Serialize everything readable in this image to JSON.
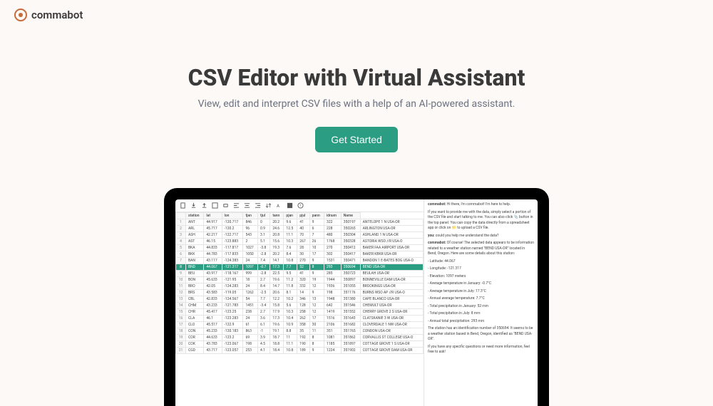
{
  "brand": {
    "name": "commabot"
  },
  "hero": {
    "title": "CSV Editor with Virtual Assistant",
    "subtitle": "View, edit and interpret CSV files with a help of an AI-powered assistant.",
    "cta": "Get Started"
  },
  "sheet": {
    "columns": [
      "station",
      "lat",
      "lon",
      "tjan",
      "tjul",
      "tann",
      "pjan",
      "pjul",
      "pann",
      "idnum",
      "Name"
    ],
    "rows": [
      {
        "n": 1,
        "c": [
          "ANT",
          "44.917",
          "-120.717",
          "846",
          "0",
          "20.2",
          "9.6",
          "41",
          "9",
          "322",
          "350197",
          "ANTELOPE 1 N USA-OR"
        ]
      },
      {
        "n": 2,
        "c": [
          "ARL",
          "45.717",
          "-120.2",
          "96",
          "0.9",
          "24.6",
          "12.5",
          "40",
          "6",
          "228",
          "350265",
          "ARLINGTON USA-OR"
        ]
      },
      {
        "n": 3,
        "c": [
          "ASH",
          "42.217",
          "-122.717",
          "543",
          "3.1",
          "20.8",
          "11.1",
          "70",
          "7",
          "480",
          "350304",
          "ASHLAND 1 N USA-OR"
        ]
      },
      {
        "n": 4,
        "c": [
          "AST",
          "46.15",
          "-123.883",
          "2",
          "5.1",
          "15.6",
          "10.3",
          "267",
          "26",
          "1768",
          "350328",
          "ASTORIA WSO //R USA-O"
        ]
      },
      {
        "n": 5,
        "c": [
          "BKA",
          "44.833",
          "-117.817",
          "1027",
          "-3.8",
          "19.3",
          "7.6",
          "28",
          "10",
          "270",
          "350412",
          "BAKER FAA AIRPORT USA-OR"
        ]
      },
      {
        "n": 6,
        "c": [
          "BKK",
          "44.783",
          "-117.833",
          "1050",
          "-2.8",
          "20.2",
          "8.4",
          "30",
          "17",
          "302",
          "350417",
          "BAKER KBKR USA-OR"
        ]
      },
      {
        "n": 7,
        "c": [
          "BAN",
          "43.117",
          "-124.383",
          "24",
          "7.4",
          "14.1",
          "10.8",
          "270",
          "9",
          "1531",
          "350471",
          "BANDON 1 E-BATES BOG USA-O"
        ]
      },
      {
        "n": 8,
        "sel": true,
        "c": [
          "BND",
          "44.067",
          "-121.317",
          "1097",
          "-0.7",
          "17.3",
          "7.7",
          "52",
          "8",
          "293",
          "350694",
          "BEND USA-OR"
        ]
      },
      {
        "n": 9,
        "c": [
          "BEU",
          "43.917",
          "-118.167",
          "999",
          "-2.8",
          "22.5",
          "9.5",
          "41",
          "9",
          "285",
          "350723",
          "BEULAH USA-OR"
        ]
      },
      {
        "n": 10,
        "c": [
          "BON",
          "45.633",
          "-121.95",
          "18",
          "2.7",
          "19.6",
          "11.2",
          "320",
          "19",
          "1944",
          "350897",
          "BONNEVILLE DAM USA-OR"
        ]
      },
      {
        "n": 11,
        "c": [
          "BRO",
          "42.05",
          "-124.283",
          "24",
          "8.4",
          "14.7",
          "11.8",
          "332",
          "12",
          "1936",
          "351055",
          "BROOKINGS USA-OR"
        ]
      },
      {
        "n": 12,
        "c": [
          "BRS",
          "43.583",
          "-119.05",
          "1262",
          "-2.5",
          "20.6",
          "8.1",
          "14",
          "9",
          "198",
          "351176",
          "BURNS WSO AP //R USA-O"
        ]
      },
      {
        "n": 13,
        "c": [
          "CBL",
          "42.833",
          "-124.567",
          "54",
          "7.7",
          "12.2",
          "10.2",
          "346",
          "13",
          "1948",
          "351380",
          "CAPE BLANCO USA-OR"
        ]
      },
      {
        "n": 14,
        "c": [
          "CHM",
          "43.233",
          "-121.783",
          "1451",
          "-3.4",
          "15.8",
          "5.6",
          "128",
          "12",
          "642",
          "351546",
          "CHEMULT USA-OR"
        ]
      },
      {
        "n": 15,
        "c": [
          "CHR",
          "45.417",
          "-123.25",
          "238",
          "2.7",
          "17.9",
          "10.3",
          "258",
          "12",
          "1419",
          "351552",
          "CHERRY GROVE 2 S USA-OR"
        ]
      },
      {
        "n": 16,
        "c": [
          "CLA",
          "46.1",
          "-123.283",
          "24",
          "3.6",
          "17.3",
          "10.4",
          "262",
          "17",
          "1516",
          "351643",
          "CLATSKANIE 3 W USA-OR"
        ]
      },
      {
        "n": 17,
        "c": [
          "CLO",
          "45.517",
          "-122.9",
          "61",
          "6.1",
          "19.6",
          "10.9",
          "358",
          "30",
          "2106",
          "351682",
          "CLOVERDALE 1 NW USA-OR"
        ]
      },
      {
        "n": 18,
        "c": [
          "CON",
          "45.233",
          "-120.183",
          "863",
          "-1",
          "19.1",
          "8.8",
          "35",
          "11",
          "351",
          "351765",
          "CONDON USA-OR"
        ]
      },
      {
        "n": 19,
        "c": [
          "COR",
          "44.633",
          "-123.2",
          "69",
          "3.9",
          "18.7",
          "11",
          "192",
          "8",
          "1081",
          "351862",
          "CORVALLIS ST COLLEGE USA-O"
        ]
      },
      {
        "n": 20,
        "c": [
          "COK",
          "43.783",
          "-123.067",
          "198",
          "4.5",
          "18.8",
          "11.1",
          "190",
          "8",
          "1185",
          "351897",
          "COTTAGE GROVE 1 S USA-OR"
        ]
      },
      {
        "n": 21,
        "c": [
          "CGD",
          "43.717",
          "-123.057",
          "253",
          "4.1",
          "18.4",
          "10.8",
          "189",
          "9",
          "1224",
          "351902",
          "COTTAGE GROVE DAM USA-OR"
        ]
      }
    ]
  },
  "chat": {
    "m1_prefix": "commabot:",
    "m1": " Hi there, I'm commabot! I'm here to help.",
    "m2": "If you want to provide me with the data, simply select a portion of the CSV file and start talking to me. You can also click 📎 button in the top panel. You can copy the data directly from a spreadsheet app or click on 📁 to upload a CSV file.",
    "m3_prefix": "you:",
    "m3": " could you help me understand the data?",
    "m4_prefix": "commabot:",
    "m4": " Of course! The selected data appears to be information related to a weather station named \"BEND USA-OR\" located in Bend, Oregon. Here are some details about this station:",
    "b1": "- Latitude: 44.067",
    "b2": "- Longitude: -121.317",
    "b3": "- Elevation: 1097 meters",
    "b4": "- Average temperature in January: -0.7°C",
    "b5": "- Average temperature in July: 17.3°C",
    "b6": "- Annual average temperature: 7.7°C",
    "b7": "- Total precipitation in January: 52 mm",
    "b8": "- Total precipitation in July: 8 mm",
    "b9": "- Annual total precipitation: 293 mm",
    "m5": "The station has an identification number of 350694. It seems to be a weather station based in Bend, Oregon, identified as \"BEND USA-OR\".",
    "m6": "If you have any specific questions or need more information, feel free to ask!"
  }
}
